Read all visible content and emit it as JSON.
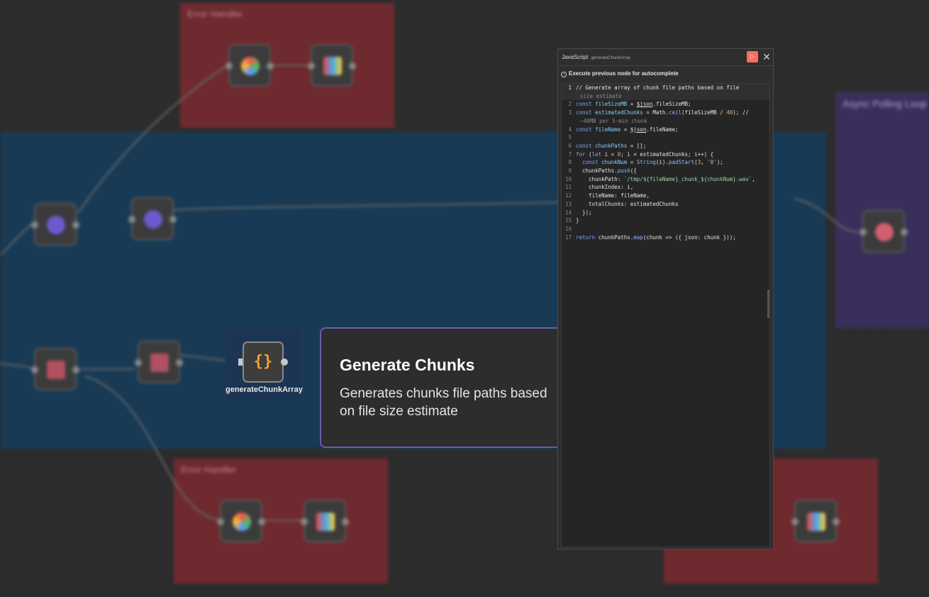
{
  "background": {
    "region_titles": [
      "Error Handler",
      "Error Handler",
      "Async Polling Loop"
    ],
    "colors": {
      "red_region": "#6e2a2e",
      "blue_region": "#183a55",
      "purple_region": "#3a2f5c"
    }
  },
  "focus_node": {
    "label": "generateChunkArray",
    "icon": "code-braces-icon",
    "glyph": "{}"
  },
  "info_card": {
    "title": "Generate Chunks",
    "description": "Generates chunks file paths based on file size estimate"
  },
  "code_panel": {
    "language": "JavaScript",
    "node_name": "generateChunkArray",
    "run_glyph": "▷",
    "close_glyph": "✕",
    "hint": "Execute previous node for autocomplete",
    "lines": [
      {
        "n": "1",
        "text": "// Generate array of chunk file paths based on file",
        "cont": "size estimate"
      },
      {
        "n": "2",
        "text": "const fileSizeMB = $json.fileSizeMB;"
      },
      {
        "n": "3",
        "text": "const estimatedChunks = Math.ceil(fileSizeMB / 40); //",
        "cont": "~40MB per 5-min chunk"
      },
      {
        "n": "4",
        "text": "const fileName = $json.fileName;"
      },
      {
        "n": "5",
        "text": ""
      },
      {
        "n": "6",
        "text": "const chunkPaths = [];"
      },
      {
        "n": "7",
        "text": "for (let i = 0; i < estimatedChunks; i++) {"
      },
      {
        "n": "8",
        "text": "  const chunkNum = String(i).padStart(3, '0');"
      },
      {
        "n": "9",
        "text": "  chunkPaths.push({"
      },
      {
        "n": "10",
        "text": "    chunkPath: `/tmp/${fileName}_chunk_${chunkNum}.wav`,"
      },
      {
        "n": "11",
        "text": "    chunkIndex: i,"
      },
      {
        "n": "12",
        "text": "    fileName: fileName,"
      },
      {
        "n": "13",
        "text": "    totalChunks: estimatedChunks"
      },
      {
        "n": "14",
        "text": "  });"
      },
      {
        "n": "15",
        "text": "}"
      },
      {
        "n": "16",
        "text": ""
      },
      {
        "n": "17",
        "text": "return chunkPaths.map(chunk => ({ json: chunk }));"
      }
    ]
  }
}
